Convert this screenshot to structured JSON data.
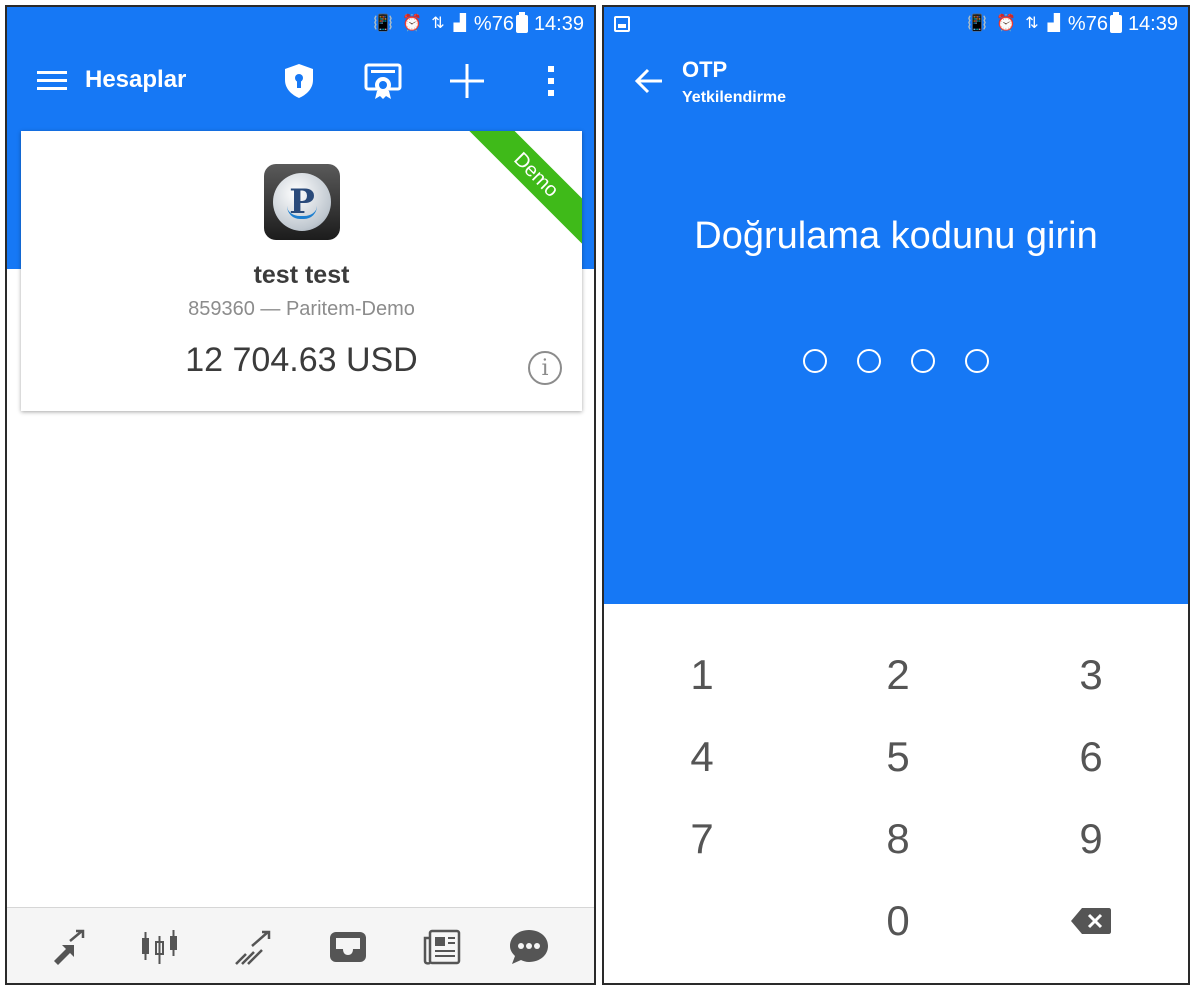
{
  "colors": {
    "primary_blue": "#1678f5",
    "demo_green": "#3fba19",
    "icon_gray": "#555555",
    "text_dark": "#3b3b3b",
    "text_muted": "#8c8c8c"
  },
  "status_bar": {
    "battery": "%76",
    "time": "14:39"
  },
  "left_screen": {
    "toolbar": {
      "title": "Hesaplar",
      "icons": [
        "menu-icon",
        "shield-lock-icon",
        "certificate-icon",
        "plus-icon",
        "more-vert-icon"
      ]
    },
    "account": {
      "badge": "Demo",
      "logo_letter": "P",
      "name": "test test",
      "number_server": "859360 — Paritem-Demo",
      "balance": "12 704.63 USD"
    },
    "bottom_nav": [
      "quotes-icon",
      "chart-icon",
      "trade-icon",
      "inbox-icon",
      "news-icon",
      "chat-icon"
    ]
  },
  "right_screen": {
    "title": "OTP",
    "subtitle": "Yetkilendirme",
    "heading": "Doğrulama kodunu girin",
    "pin_length": 4,
    "keypad": [
      "1",
      "2",
      "3",
      "4",
      "5",
      "6",
      "7",
      "8",
      "9",
      "0"
    ]
  }
}
